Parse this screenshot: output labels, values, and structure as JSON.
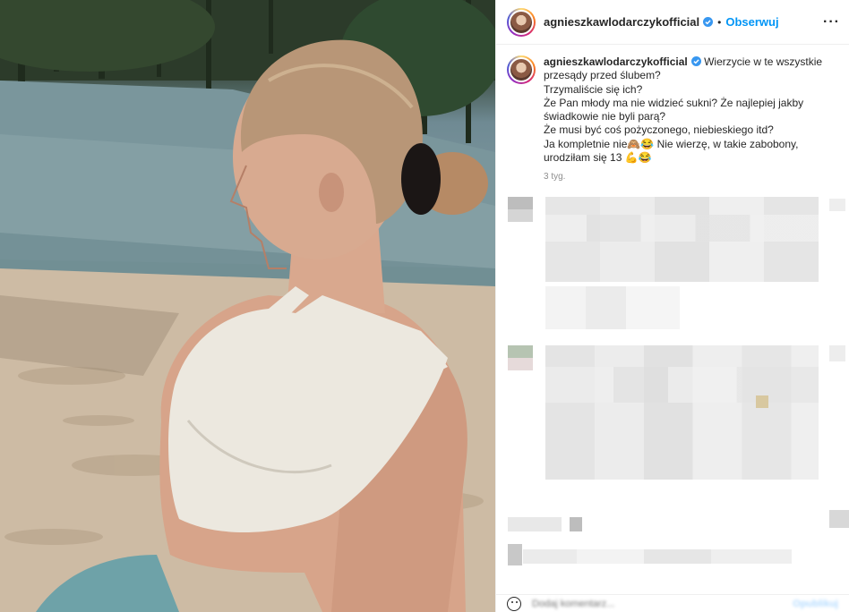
{
  "post": {
    "author": "agnieszkawlodarczykofficial",
    "follow_label": "Obserwuj",
    "separator": "•",
    "more_label": "···",
    "caption_lines": [
      "Wierzycie w te wszystkie przesądy przed ślubem?",
      "Trzymaliście się ich?",
      "Że Pan młody ma nie widzieć sukni? Że najlepiej jakby świadkowie nie byli parą?",
      "Że musi być coś pożyczonego, niebieskiego itd?",
      "Ja kompletnie nie🙈😂 Nie wierzę, w takie zabobony, urodziłam się 13 💪😂"
    ],
    "time_ago": "3 tyg."
  },
  "comment_box": {
    "placeholder": "Dodaj komentarz...",
    "post_label": "Opublikuj"
  },
  "colors": {
    "follow": "#0095f6",
    "verified": "#3897f0",
    "secondary_text": "#8e8e8e"
  },
  "icons": [
    "verified-badge-icon",
    "more-options-icon",
    "emoji-icon"
  ]
}
